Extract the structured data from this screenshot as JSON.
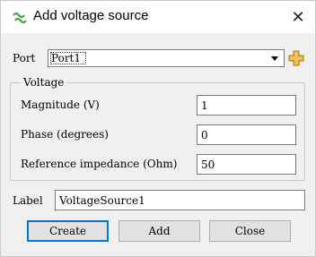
{
  "window": {
    "title": "Add voltage source",
    "app_icon": "voltage-source-app-icon",
    "close_icon": "close-icon"
  },
  "port": {
    "label": "Port",
    "selected": "Port1",
    "add_icon": "add-port-icon"
  },
  "voltage_group": {
    "title": "Voltage",
    "magnitude": {
      "label": "Magnitude (V)",
      "value": "1"
    },
    "phase": {
      "label": "Phase (degrees)",
      "value": "0"
    },
    "impedance": {
      "label": "Reference impedance (Ohm)",
      "value": "50"
    }
  },
  "name": {
    "label": "Label",
    "value": "VoltageSource1"
  },
  "buttons": {
    "create": "Create",
    "add": "Add",
    "close": "Close"
  },
  "colors": {
    "default_button_border": "#0078d7",
    "plus_icon": "#e6a83a"
  }
}
